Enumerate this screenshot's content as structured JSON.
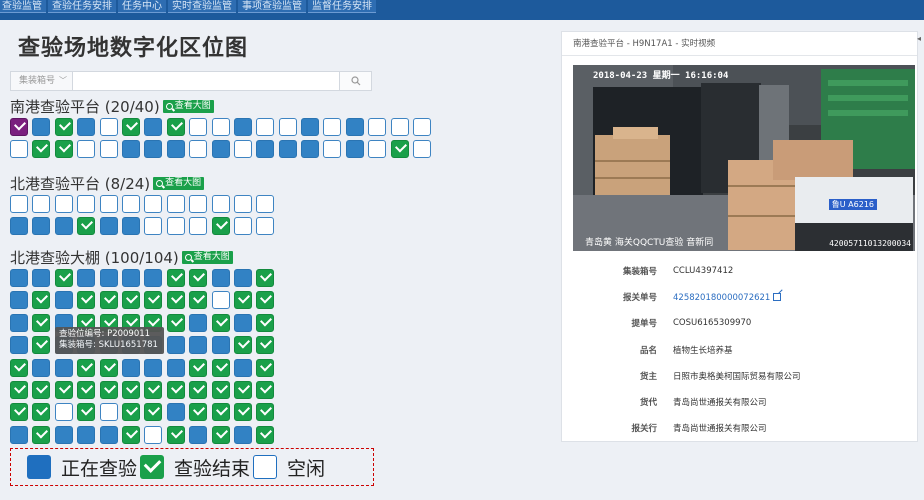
{
  "nav": {
    "tabs": [
      "查验监管",
      "查验任务安排",
      "任务中心",
      "实时查验监管",
      "事项查验监管",
      "监督任务安排"
    ]
  },
  "page_title": "查验场地数字化区位图",
  "search": {
    "select_label": "集装箱号",
    "placeholder": "",
    "button_icon": "search-icon"
  },
  "view_big_label": "查看大图",
  "areas": [
    {
      "title": "南港查验平台 (20/40)",
      "rows": [
        "sbdbfdbdffbffbfbfff",
        "fddffbbbfbfbbbfbfdf"
      ]
    },
    {
      "title": "北港查验平台 (8/24)",
      "rows": [
        "ffffffffffff",
        "bbbdbbfffdff"
      ]
    },
    {
      "title": "北港查验大棚 (100/104)",
      "rows": [
        "bbdbbbbddbbd",
        "bdbddddddfdd",
        "bdbdddddbdbd",
        "bdbbbbbbbbdd",
        "dbbddbbbddbd",
        "dddddddddddd",
        "ddfdfddbdddd",
        "bdbbbdfdbdbd"
      ]
    }
  ],
  "tooltip": {
    "line1": "查验位编号: P2009011",
    "line2": "集装箱号: SKLU1651781"
  },
  "legend": {
    "busy": "正在查验",
    "done": "查验结束",
    "free": "空闲"
  },
  "panel": {
    "title": "南港查验平台 - H9N17A1 - 实时视频",
    "video": {
      "timestamp": "2018-04-23 星期一 16:16:04",
      "caption": "青岛黄  海关QQCTU查验  音新同",
      "plate": "鲁U A6216",
      "code": "42005711013200034"
    },
    "fields": [
      {
        "label": "集装箱号",
        "value": "CCLU4397412"
      },
      {
        "label": "报关单号",
        "value": "425820180000072621",
        "link": true
      },
      {
        "label": "提单号",
        "value": "COSU6165309970"
      },
      {
        "label": "品名",
        "value": "植物生长培养基"
      },
      {
        "label": "货主",
        "value": "日照市奥格美柯国际贸易有限公司"
      },
      {
        "label": "货代",
        "value": "青岛尚世通报关有限公司"
      },
      {
        "label": "报关行",
        "value": "青岛尚世通报关有限公司"
      }
    ]
  },
  "colors": {
    "busy": "#3282c4",
    "done": "#1aa04a",
    "selected": "#7a1f7e",
    "free_border": "#3e84c2",
    "nav": "#1d5a9c"
  }
}
